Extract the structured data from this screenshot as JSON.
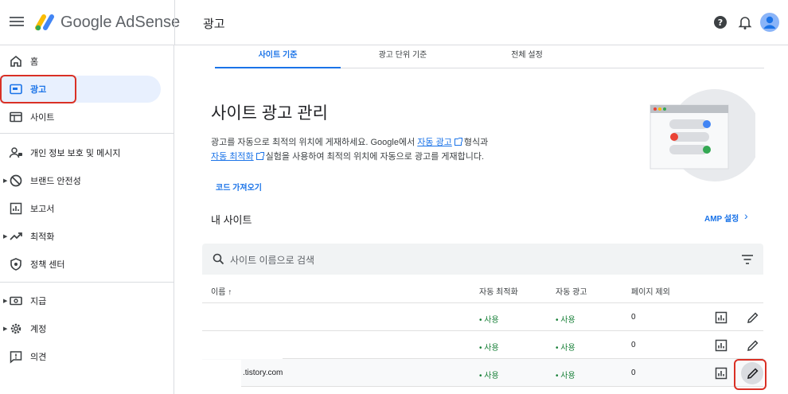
{
  "topbar": {
    "brand": "Google AdSense",
    "page_title": "광고"
  },
  "sidebar": {
    "items": [
      {
        "label": "홈"
      },
      {
        "label": "광고"
      },
      {
        "label": "사이트"
      },
      {
        "label": "개인 정보 보호 및 메시지"
      },
      {
        "label": "브랜드 안전성"
      },
      {
        "label": "보고서"
      },
      {
        "label": "최적화"
      },
      {
        "label": "정책 센터"
      },
      {
        "label": "지급"
      },
      {
        "label": "계정"
      },
      {
        "label": "의견"
      }
    ]
  },
  "tabs": [
    {
      "label": "사이트 기준"
    },
    {
      "label": "광고 단위 기준"
    },
    {
      "label": "전체 설정"
    }
  ],
  "main": {
    "heading": "사이트 광고 관리",
    "desc_1": "광고를 자동으로 최적의 위치에 게재하세요. Google에서",
    "desc_link1": "자동 광고",
    "desc_2": "형식과",
    "desc_link2": "자동 최적화",
    "desc_3": "실험을 사용하여 최적의 위치에 자동으로 광고를 게재합니다.",
    "code_link": "코드 가져오기",
    "my_sites": "내 사이트",
    "amp_link": "AMP 설정",
    "search_placeholder": "사이트 이름으로 검색"
  },
  "table": {
    "columns": [
      "이름",
      "자동 최적화",
      "자동 광고",
      "페이지 제외"
    ],
    "sort_arrow": "↑",
    "rows": [
      {
        "name": "",
        "auto_opt": "• 사용",
        "auto_ads": "• 사용",
        "excluded": "0"
      },
      {
        "name": "",
        "auto_opt": "• 사용",
        "auto_ads": "• 사용",
        "excluded": "0"
      },
      {
        "name": ".tistory.com",
        "auto_opt": "• 사용",
        "auto_ads": "• 사용",
        "excluded": "0"
      }
    ]
  },
  "colors": {
    "accent": "#1a73e8",
    "status_green": "#188038",
    "highlight_red": "#d93025"
  }
}
